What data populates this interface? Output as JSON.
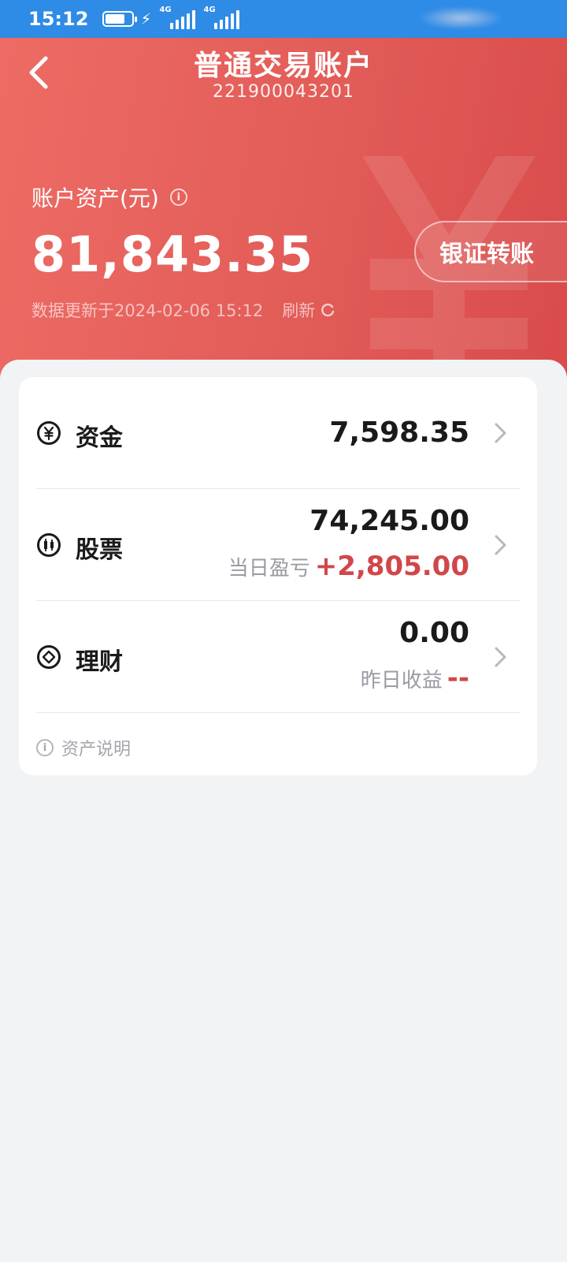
{
  "status_bar": {
    "time": "15:12",
    "network_1": "4G",
    "network_2": "4G"
  },
  "header": {
    "title": "普通交易账户",
    "account_number": "221900043201",
    "asset_label": "账户资产(元)",
    "asset_value": "81,843.35",
    "update_text": "数据更新于2024-02-06 15:12",
    "refresh_label": "刷新",
    "transfer_button": "银证转账"
  },
  "assets": {
    "cash": {
      "label": "资金",
      "value": "7,598.35",
      "icon": "yuan-circle-icon"
    },
    "stocks": {
      "label": "股票",
      "value": "74,245.00",
      "sub_label": "当日盈亏",
      "sub_value": "+2,805.00",
      "icon": "candlestick-icon"
    },
    "wealth": {
      "label": "理财",
      "value": "0.00",
      "sub_label": "昨日收益",
      "sub_value": "--",
      "icon": "diamond-circle-icon"
    }
  },
  "note": {
    "label": "资产说明"
  },
  "colors": {
    "status_bar": "#2e8be6",
    "header_red": "#e25c58",
    "profit_red": "#d0474a"
  }
}
